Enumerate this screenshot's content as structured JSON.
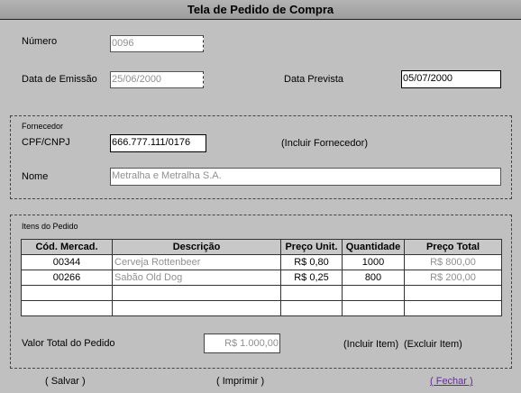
{
  "title": "Tela de Pedido de Compra",
  "numero": {
    "label": "Número",
    "value": "0096"
  },
  "emissao": {
    "label": "Data de Emissão",
    "value": "25/06/2000"
  },
  "prevista": {
    "label": "Data Prevista",
    "value": "05/07/2000"
  },
  "fornecedor": {
    "group": "Fornecedor",
    "cpf_label": "CPF/CNPJ",
    "cpf_value": "666.777.111/0176",
    "incluir": "(Incluir Fornecedor)",
    "nome_label": "Nome",
    "nome_value": "Metralha e Metralha S.A."
  },
  "itens": {
    "group": "Itens do Pedido",
    "columns": [
      "Cód. Mercad.",
      "Descrição",
      "Preço Unit.",
      "Quantidade",
      "Preço Total"
    ],
    "rows": [
      [
        "00344",
        "Cerveja Rottenbeer",
        "R$ 0,80",
        "1000",
        "R$ 800,00"
      ],
      [
        "00266",
        "Sabão Old Dog",
        "R$ 0,25",
        "800",
        "R$ 200,00"
      ],
      [
        "",
        "",
        "",
        "",
        ""
      ],
      [
        "",
        "",
        "",
        "",
        ""
      ]
    ],
    "total_label": "Valor Total do Pedido",
    "total_value": "R$ 1.000,00",
    "incluir": "(Incluir Item)",
    "excluir": "(Excluir Item)"
  },
  "actions": {
    "salvar": "( Salvar )",
    "imprimir": "( Imprimir )",
    "fechar": "( Fechar )"
  }
}
